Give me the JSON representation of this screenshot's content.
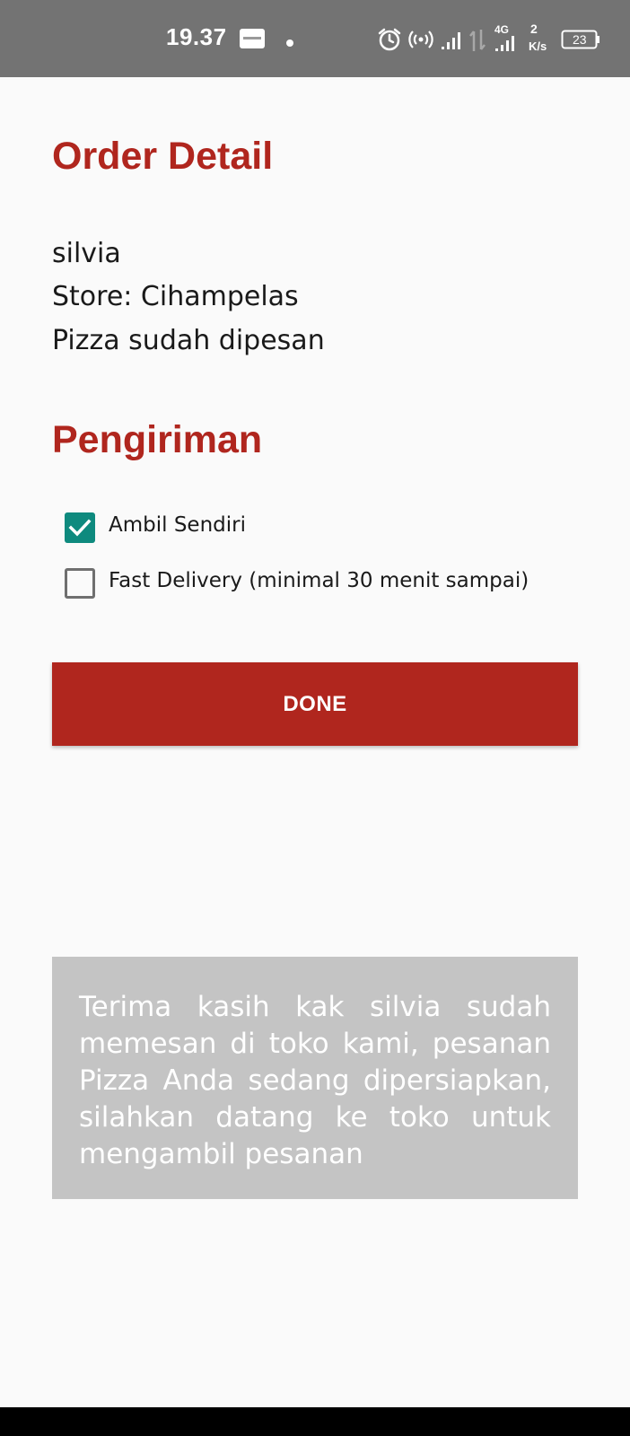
{
  "status_bar": {
    "time": "19.37",
    "network_type": "4G",
    "speed_value": "2",
    "speed_unit": "K/s",
    "battery_level": "23",
    "icons": [
      "notification-app-icon",
      "dot-icon",
      "alarm-icon",
      "hotspot-icon",
      "signal-icon",
      "data-arrows-icon",
      "signal-4g-icon",
      "battery-icon"
    ]
  },
  "order": {
    "title": "Order Detail",
    "customer_name": "silvia",
    "store": "Store: Cihampelas",
    "status": "Pizza sudah dipesan"
  },
  "delivery": {
    "title": "Pengiriman",
    "options": [
      {
        "label": "Ambil Sendiri",
        "checked": true
      },
      {
        "label": "Fast Delivery (minimal 30 menit sampai)",
        "checked": false
      }
    ]
  },
  "actions": {
    "done_label": "DONE"
  },
  "message": {
    "text": "Terima kasih kak silvia sudah memesan di toko kami, pesanan Pizza Anda sedang dipersiapkan, silahkan datang ke toko untuk mengambil pesanan"
  },
  "colors": {
    "accent": "#b0261e",
    "checkbox_checked": "#0e8a7e",
    "message_bg": "#c4c4c4",
    "status_bar_bg": "#737373"
  }
}
